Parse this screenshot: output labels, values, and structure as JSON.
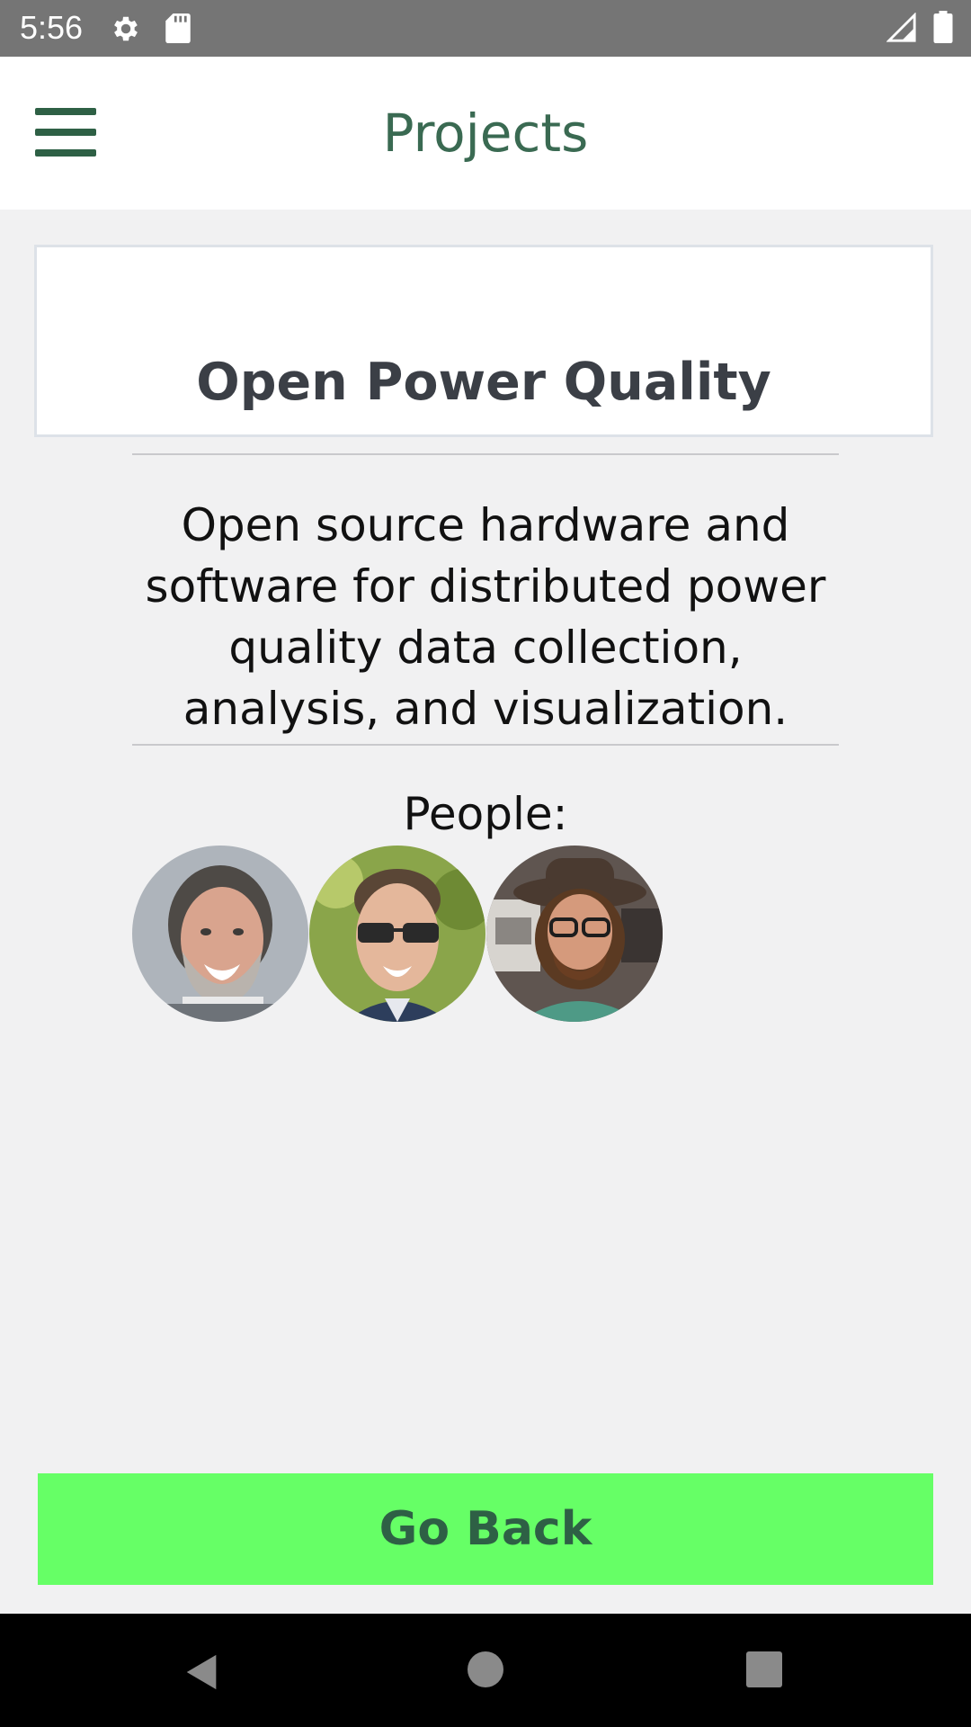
{
  "status_bar": {
    "time": "5:56",
    "icons": [
      "gear-icon",
      "sd-card-icon",
      "signal-icon",
      "battery-icon"
    ]
  },
  "app_bar": {
    "title": "Projects",
    "menu_icon": "hamburger-menu-icon",
    "title_color": "#3a6a52"
  },
  "project": {
    "title": "Open Power Quality",
    "description": "Open source hardware and software for distributed power quality data collection, analysis, and visualization.",
    "people_label": "People:",
    "people": [
      {
        "avatar": "person-1-avatar"
      },
      {
        "avatar": "person-2-avatar"
      },
      {
        "avatar": "person-3-avatar"
      }
    ]
  },
  "actions": {
    "go_back_label": "Go Back",
    "go_back_color": "#66ff66"
  },
  "nav_bar": {
    "icons": [
      "back-icon",
      "home-icon",
      "recents-icon"
    ]
  }
}
